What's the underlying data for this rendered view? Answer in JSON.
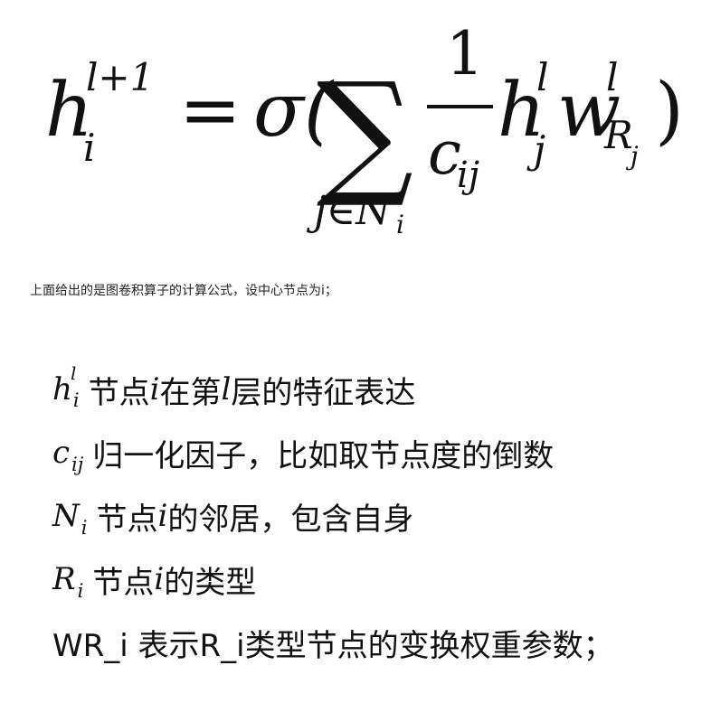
{
  "formula": {
    "lhs_base": "h",
    "lhs_sup": "l+1",
    "lhs_sub": "i",
    "equals": "=",
    "sigma": "σ(",
    "sum_symbol": "∑",
    "sum_sub": "j∈N",
    "sum_sub_i": "i",
    "frac_num": "1",
    "frac_den_base": "c",
    "frac_den_sub": "ij",
    "h_base": "h",
    "h_sup": "l",
    "h_sub": "j",
    "w_base": "w",
    "w_sup": "l",
    "w_sub": "R",
    "w_sub_sub": "j",
    "close_paren": ")"
  },
  "caption": "上面给出的是图卷积算子的计算公式，设中心节点为i；",
  "definitions": [
    {
      "symbol": "h",
      "symbol_sup": "l",
      "symbol_sub": "i",
      "text_parts": [
        "节点",
        "i",
        "在第",
        "l",
        "层的特征表达"
      ]
    },
    {
      "symbol": "c",
      "symbol_sub": "ij",
      "text": "归一化因子，比如取节点度的倒数"
    },
    {
      "symbol": "N",
      "symbol_sub": "i",
      "text_parts": [
        "节点",
        "i",
        " 的邻居，包含自身"
      ]
    },
    {
      "symbol": "R",
      "symbol_sub": "i",
      "text_parts": [
        "节点",
        "i",
        " 的类型"
      ]
    },
    {
      "text": "WR_i 表示R_i类型节点的变换权重参数；"
    }
  ]
}
